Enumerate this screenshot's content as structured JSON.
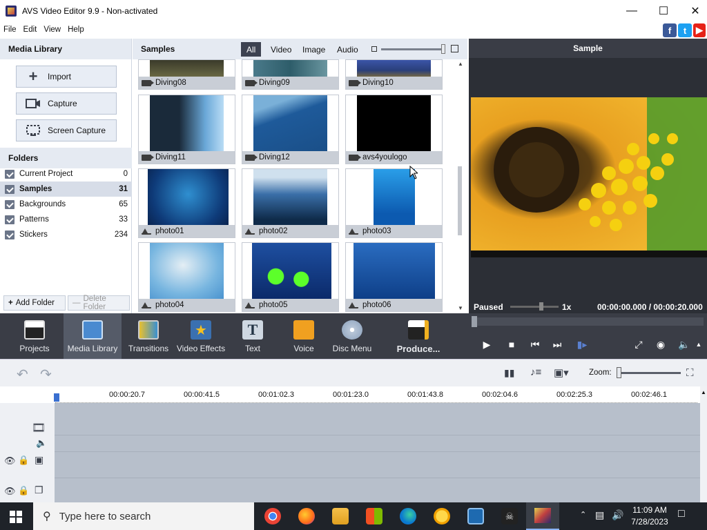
{
  "window": {
    "title": "AVS Video Editor 9.9 - Non-activated"
  },
  "menu": [
    "File",
    "Edit",
    "View",
    "Help"
  ],
  "media_library": {
    "header": "Media Library",
    "buttons": {
      "import": "Import",
      "capture": "Capture",
      "screen_capture": "Screen Capture"
    },
    "folders_header": "Folders",
    "folders": [
      {
        "name": "Current Project",
        "count": "0"
      },
      {
        "name": "Samples",
        "count": "31"
      },
      {
        "name": "Backgrounds",
        "count": "65"
      },
      {
        "name": "Patterns",
        "count": "33"
      },
      {
        "name": "Stickers",
        "count": "234"
      }
    ],
    "add_folder": "Add Folder",
    "delete_folder": "Delete Folder"
  },
  "samples": {
    "header": "Samples",
    "filters": [
      "All",
      "Video",
      "Image",
      "Audio"
    ],
    "active_filter": "All",
    "items": [
      {
        "name": "Diving08",
        "kind": "video"
      },
      {
        "name": "Diving09",
        "kind": "video"
      },
      {
        "name": "Diving10",
        "kind": "video"
      },
      {
        "name": "Diving11",
        "kind": "video"
      },
      {
        "name": "Diving12",
        "kind": "video"
      },
      {
        "name": "avs4youlogo",
        "kind": "video"
      },
      {
        "name": "photo01",
        "kind": "image"
      },
      {
        "name": "photo02",
        "kind": "image"
      },
      {
        "name": "photo03",
        "kind": "image"
      },
      {
        "name": "photo04",
        "kind": "image"
      },
      {
        "name": "photo05",
        "kind": "image"
      },
      {
        "name": "photo06",
        "kind": "image"
      }
    ]
  },
  "preview": {
    "header": "Sample",
    "status": "Paused",
    "speed": "1x",
    "time": "00:00:00.000 / 00:00:20.000"
  },
  "toolbar": {
    "items": [
      {
        "label": "Projects"
      },
      {
        "label": "Media Library"
      },
      {
        "label": "Transitions"
      },
      {
        "label": "Video Effects"
      },
      {
        "label": "Text"
      },
      {
        "label": "Voice"
      },
      {
        "label": "Disc Menu"
      },
      {
        "label": "Produce..."
      }
    ],
    "selected": "Media Library"
  },
  "timeline": {
    "zoom_label": "Zoom:",
    "ruler": [
      "00:00:20.7",
      "00:00:41.5",
      "00:01:02.3",
      "00:01:23.0",
      "00:01:43.8",
      "00:02:04.6",
      "00:02:25.3",
      "00:02:46.1"
    ]
  },
  "taskbar": {
    "search_placeholder": "Type here to search",
    "time": "11:09 AM",
    "date": "7/28/2023"
  },
  "colors": {
    "facebook": "#3b5998",
    "twitter": "#1da1f2",
    "youtube": "#e62117",
    "toolbar_bg": "#3a3d46",
    "accent_track": "#b7bfcb"
  }
}
